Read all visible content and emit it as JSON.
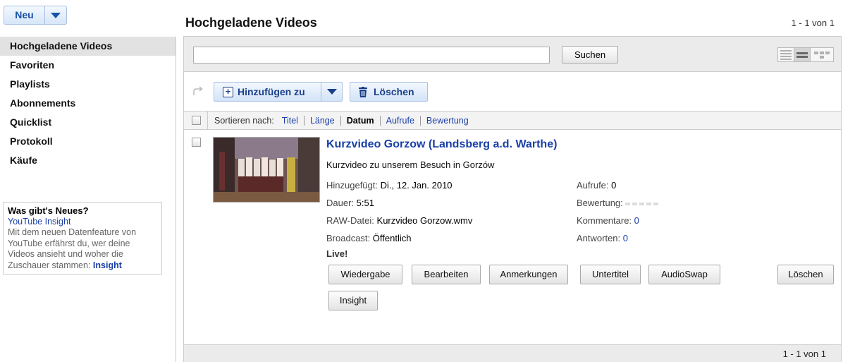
{
  "new_button": {
    "label": "Neu"
  },
  "sidebar": {
    "items": [
      {
        "label": "Hochgeladene Videos",
        "active": true
      },
      {
        "label": "Favoriten"
      },
      {
        "label": "Playlists"
      },
      {
        "label": "Abonnements"
      },
      {
        "label": "Quicklist"
      },
      {
        "label": "Protokoll"
      },
      {
        "label": "Käufe"
      }
    ],
    "news": {
      "title": "Was gibt's Neues?",
      "link": "YouTube Insight",
      "body": "Mit dem neuen Datenfeature von YouTube erfährst du, wer deine Videos ansieht und woher die Zuschauer stammen:",
      "body_link": "Insight"
    }
  },
  "header": {
    "title": "Hochgeladene Videos",
    "count": "1 - 1 von 1"
  },
  "search": {
    "value": "",
    "button_label": "Suchen"
  },
  "actions": {
    "add_label": "Hinzufügen zu",
    "delete_label": "Löschen"
  },
  "sort": {
    "label": "Sortieren nach:",
    "options": [
      "Titel",
      "Länge",
      "Datum",
      "Aufrufe",
      "Bewertung"
    ],
    "active": "Datum"
  },
  "video": {
    "title": "Kurzvideo Gorzow (Landsberg a.d. Warthe)",
    "description": "Kurzvideo zu unserem Besuch in Gorzów",
    "added_label": "Hinzugefügt:",
    "added_value": "Di., 12. Jan. 2010",
    "duration_label": "Dauer:",
    "duration_value": "5:51",
    "raw_label": "RAW-Datei:",
    "raw_value": "Kurzvideo Gorzow.wmv",
    "broadcast_label": "Broadcast:",
    "broadcast_value": "Öffentlich",
    "live": "Live!",
    "views_label": "Aufrufe:",
    "views_value": "0",
    "rating_label": "Bewertung:",
    "rating_value": 0,
    "comments_label": "Kommentare:",
    "comments_value": "0",
    "replies_label": "Antworten:",
    "replies_value": "0",
    "buttons": {
      "play": "Wiedergabe",
      "edit": "Bearbeiten",
      "annotations": "Anmerkungen",
      "subtitles": "Untertitel",
      "audioswap": "AudioSwap",
      "delete": "Löschen",
      "insight": "Insight"
    }
  },
  "footer": {
    "count": "1 - 1 von 1"
  }
}
